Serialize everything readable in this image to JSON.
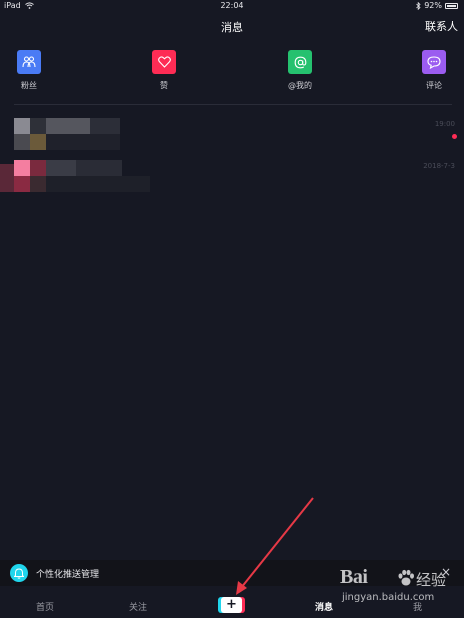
{
  "status_bar": {
    "device": "iPad",
    "time": "22:04",
    "battery": "92%"
  },
  "nav": {
    "title": "消息",
    "contacts": "联系人"
  },
  "quick_actions": [
    {
      "label": "粉丝",
      "icon": "fans-icon",
      "color": "#4a7bf5"
    },
    {
      "label": "赞",
      "icon": "heart-icon",
      "color": "#fe2c55"
    },
    {
      "label": "@我的",
      "icon": "at-icon",
      "color": "#25c16f"
    },
    {
      "label": "评论",
      "icon": "comment-icon",
      "color": "#9b5cf0"
    }
  ],
  "messages": [
    {
      "time": "19:00",
      "unread": true
    },
    {
      "time": "2018-7-3",
      "unread": false
    }
  ],
  "push_banner": {
    "text": "个性化推送管理",
    "close": "×"
  },
  "tabs": {
    "home": "首页",
    "follow": "关注",
    "plus": "+",
    "messages": "消息",
    "me": "我"
  },
  "watermark": {
    "logo": "Bai",
    "logo_suffix": "经验",
    "url": "jingyan.baidu.com"
  },
  "colors": {
    "background": "#161823",
    "accent_red": "#fe2c55",
    "accent_cyan": "#20d5ec"
  }
}
